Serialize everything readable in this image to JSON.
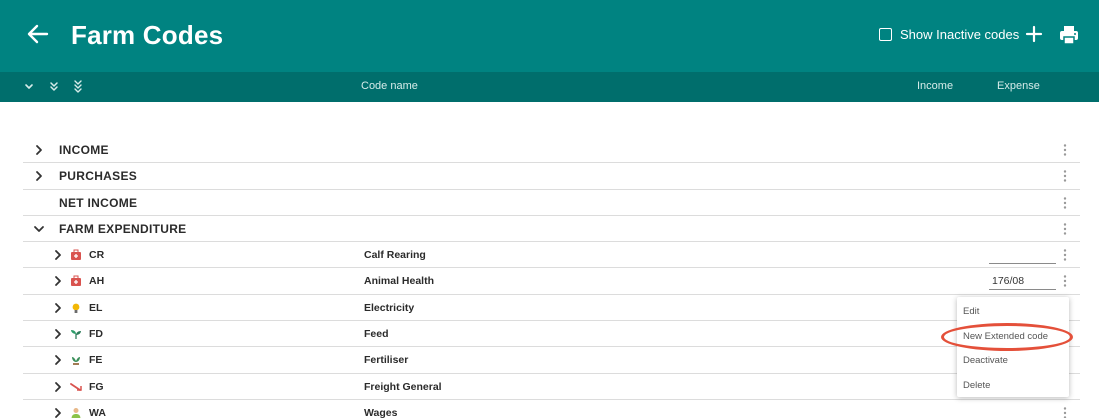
{
  "header": {
    "title": "Farm Codes",
    "show_inactive_label": "Show Inactive codes",
    "icons": [
      "back-arrow-icon",
      "add-icon",
      "print-icon"
    ]
  },
  "columns": {
    "code_name": "Code name",
    "income": "Income",
    "expense": "Expense"
  },
  "groups": [
    {
      "label": "INCOME",
      "expanded": false
    },
    {
      "label": "PURCHASES",
      "expanded": false
    },
    {
      "label": "NET INCOME",
      "expanded": null
    },
    {
      "label": "FARM EXPENDITURE",
      "expanded": true
    }
  ],
  "codes": [
    {
      "code": "CR",
      "name": "Calf Rearing",
      "expense": "",
      "icon": "medical-kit-icon"
    },
    {
      "code": "AH",
      "name": "Animal Health",
      "expense": "176/08",
      "icon": "medical-kit-icon"
    },
    {
      "code": "EL",
      "name": "Electricity",
      "icon": "lightbulb-icon"
    },
    {
      "code": "FD",
      "name": "Feed",
      "icon": "seedling-icon"
    },
    {
      "code": "FE",
      "name": "Fertiliser",
      "icon": "fertiliser-icon"
    },
    {
      "code": "FG",
      "name": "Freight General",
      "icon": "freight-icon"
    },
    {
      "code": "WA",
      "name": "Wages",
      "icon": "worker-icon"
    }
  ],
  "context_menu": {
    "items": [
      "Edit",
      "New Extended code",
      "Deactivate",
      "Delete"
    ],
    "highlighted": "New Extended code"
  },
  "colors": {
    "header": "#008381",
    "subheader": "#006e6c",
    "highlight": "#e4503a"
  }
}
